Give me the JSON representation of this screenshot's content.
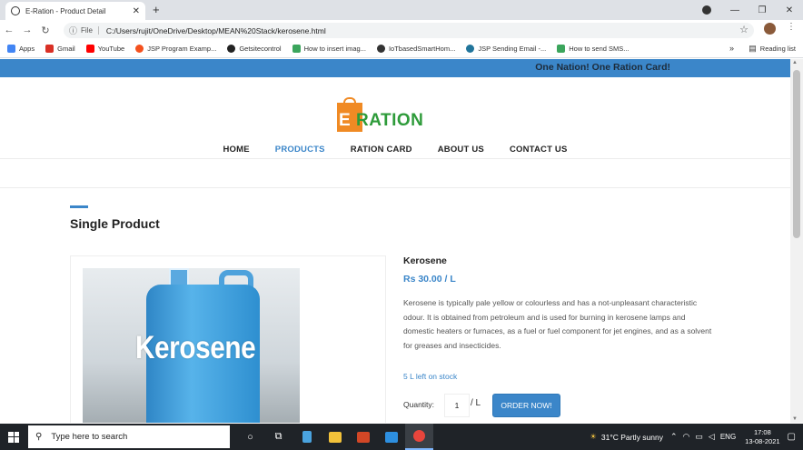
{
  "browser": {
    "tab_title": "E-Ration - Product Detail",
    "new_tab": "+",
    "address_scheme": "File",
    "url": "C:/Users/rujit/OneDrive/Desktop/MEAN%20Stack/kerosene.html",
    "bookmarks": [
      {
        "label": "Apps",
        "color": "#4285f4"
      },
      {
        "label": "Gmail",
        "color": "#d93025"
      },
      {
        "label": "YouTube",
        "color": "#ff0000"
      },
      {
        "label": "JSP Program Examp...",
        "color": "#f4511e"
      },
      {
        "label": "Getsitecontrol",
        "color": "#222222"
      },
      {
        "label": "How to insert imag...",
        "color": "#3ba55c"
      },
      {
        "label": "IoTbasedSmartHom...",
        "color": "#333333"
      },
      {
        "label": "JSP Sending Email -...",
        "color": "#21759b"
      },
      {
        "label": "How to send SMS...",
        "color": "#3ba55c"
      }
    ],
    "bookmarks_more": "»",
    "reading_list": "Reading list"
  },
  "site": {
    "topbar_text": "One Nation! One Ration Card!",
    "logo_text_e": "E",
    "logo_text_rest": " RATION",
    "nav": [
      "HOME",
      "PRODUCTS",
      "RATION CARD",
      "ABOUT US",
      "CONTACT US"
    ],
    "active_nav": "PRODUCTS",
    "section_title": "Single Product",
    "product": {
      "image_label": "Kerosene",
      "name": "Kerosene",
      "price": "Rs 30.00 / L",
      "description": "Kerosene is typically pale yellow or colourless and has a not-unpleasant characteristic odour. It is obtained from petroleum and is used for burning in kerosene lamps and domestic heaters or furnaces, as a fuel or fuel component for jet engines, and as a solvent for greases and insecticides.",
      "stock": "5 L left on stock",
      "quantity_label": "Quantity:",
      "quantity_value": "1",
      "quantity_unit": "/ L",
      "order_button": "ORDER NOW!"
    },
    "colors": {
      "accent": "#3b86c9",
      "logo_green": "#2e9b3a",
      "logo_orange": "#f08a24"
    }
  },
  "taskbar": {
    "search_placeholder": "Type here to search",
    "weather": "31°C  Partly sunny",
    "language": "ENG",
    "time": "17:08",
    "date": "13-08-2021"
  }
}
